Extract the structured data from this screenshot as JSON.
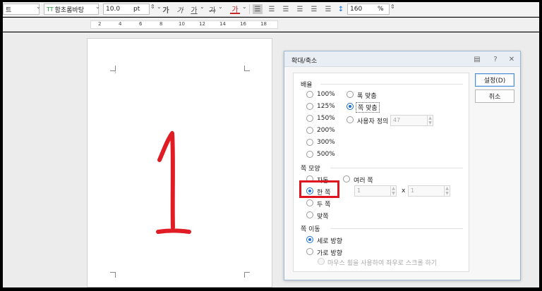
{
  "toolbar": {
    "style_value": "트",
    "font_value": "함초롬바탕",
    "font_prefix": "TT",
    "size_value": "10.0",
    "size_unit": "pt",
    "bold": "가",
    "italic": "가",
    "underline": "가",
    "strike": "가",
    "color": "가",
    "spacing_value": "160",
    "spacing_unit": "%"
  },
  "ruler": {
    "numbers": [
      "2",
      "4",
      "6",
      "8",
      "10",
      "12",
      "14",
      "16",
      "18"
    ]
  },
  "document": {
    "big_numeral": "1",
    "caret": "ˀ"
  },
  "dialog": {
    "title": "확대/축소",
    "close": "✕",
    "help": "?",
    "info": "▤",
    "zoom_group": "배율",
    "zoom_options": [
      "100%",
      "125%",
      "150%",
      "200%",
      "300%",
      "500%"
    ],
    "fit_options": [
      "폭 맞춤",
      "쪽 맞춤",
      "사용자 정의"
    ],
    "custom_value": "47",
    "page_group": "쪽 모양",
    "page_options": [
      "자동",
      "한 쪽",
      "두 쪽",
      "맞쪽"
    ],
    "multi_option": "여러 쪽",
    "multi_rows": "1",
    "multi_x": "x",
    "multi_cols": "1",
    "move_group": "쪽 이동",
    "move_options": [
      "세로 방향",
      "가로 방향"
    ],
    "scroll_option": "마우스 휠을 사용하여 좌우로 스크롤 하기",
    "ok_button": "설정(D)",
    "cancel_button": "취소"
  },
  "colors": {
    "highlight": "#e0141e",
    "accent": "#1a6fd6",
    "ink": "#e01c24"
  }
}
